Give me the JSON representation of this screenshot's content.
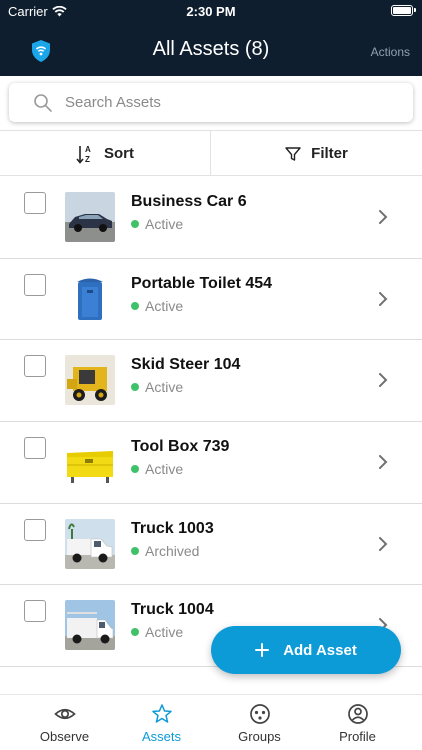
{
  "status_bar": {
    "carrier": "Carrier",
    "time": "2:30 PM"
  },
  "nav": {
    "title": "All Assets (8)",
    "actions_label": "Actions",
    "logo_icon": "wifi-shield-logo"
  },
  "search": {
    "placeholder": "Search Assets",
    "value": ""
  },
  "toolbar": {
    "sort_label": "Sort",
    "filter_label": "Filter"
  },
  "assets": [
    {
      "name": "Business Car 6",
      "status": "Active",
      "thumb": "car"
    },
    {
      "name": "Portable Toilet 454",
      "status": "Active",
      "thumb": "portable-toilet"
    },
    {
      "name": "Skid Steer 104",
      "status": "Active",
      "thumb": "skid-steer"
    },
    {
      "name": "Tool Box 739",
      "status": "Active",
      "thumb": "tool-box"
    },
    {
      "name": "Truck 1003",
      "status": "Archived",
      "thumb": "truck-white"
    },
    {
      "name": "Truck 1004",
      "status": "Active",
      "thumb": "utility-truck"
    }
  ],
  "add_button": {
    "label": "Add Asset"
  },
  "tabs": [
    {
      "label": "Observe",
      "icon": "eye-icon",
      "active": false
    },
    {
      "label": "Assets",
      "icon": "star-icon",
      "active": true
    },
    {
      "label": "Groups",
      "icon": "groups-icon",
      "active": false
    },
    {
      "label": "Profile",
      "icon": "profile-icon",
      "active": false
    }
  ],
  "colors": {
    "header_bg": "#0f1e2e",
    "accent": "#0d9bd8",
    "active_dot": "#3fc16a"
  }
}
